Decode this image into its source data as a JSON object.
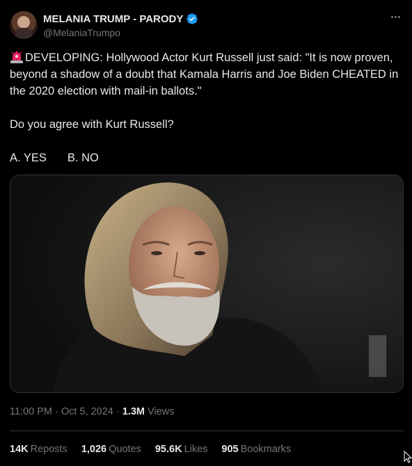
{
  "author": {
    "display_name": "MELANIA TRUMP - PARODY",
    "handle": "@MelaniaTrumpo"
  },
  "post": {
    "line1": "DEVELOPING: Hollywood Actor Kurt Russell just said: \"It is now proven, beyond a shadow of a doubt that Kamala Harris and Joe Biden CHEATED in the 2020 election with mail-in ballots.\"",
    "question": "Do you agree with Kurt Russell?",
    "option_a": "A. YES",
    "option_b": "B. NO"
  },
  "meta": {
    "time": "11:00 PM",
    "date": "Oct 5, 2024",
    "views_count": "1.3M",
    "views_label": "Views"
  },
  "stats": {
    "reposts_count": "14K",
    "reposts_label": "Reposts",
    "quotes_count": "1,026",
    "quotes_label": "Quotes",
    "likes_count": "95.6K",
    "likes_label": "Likes",
    "bookmarks_count": "905",
    "bookmarks_label": "Bookmarks"
  },
  "colors": {
    "background": "#000000",
    "text": "#e7e9ea",
    "secondary": "#71767b",
    "verified": "#1d9bf0",
    "border": "#2f3336"
  }
}
